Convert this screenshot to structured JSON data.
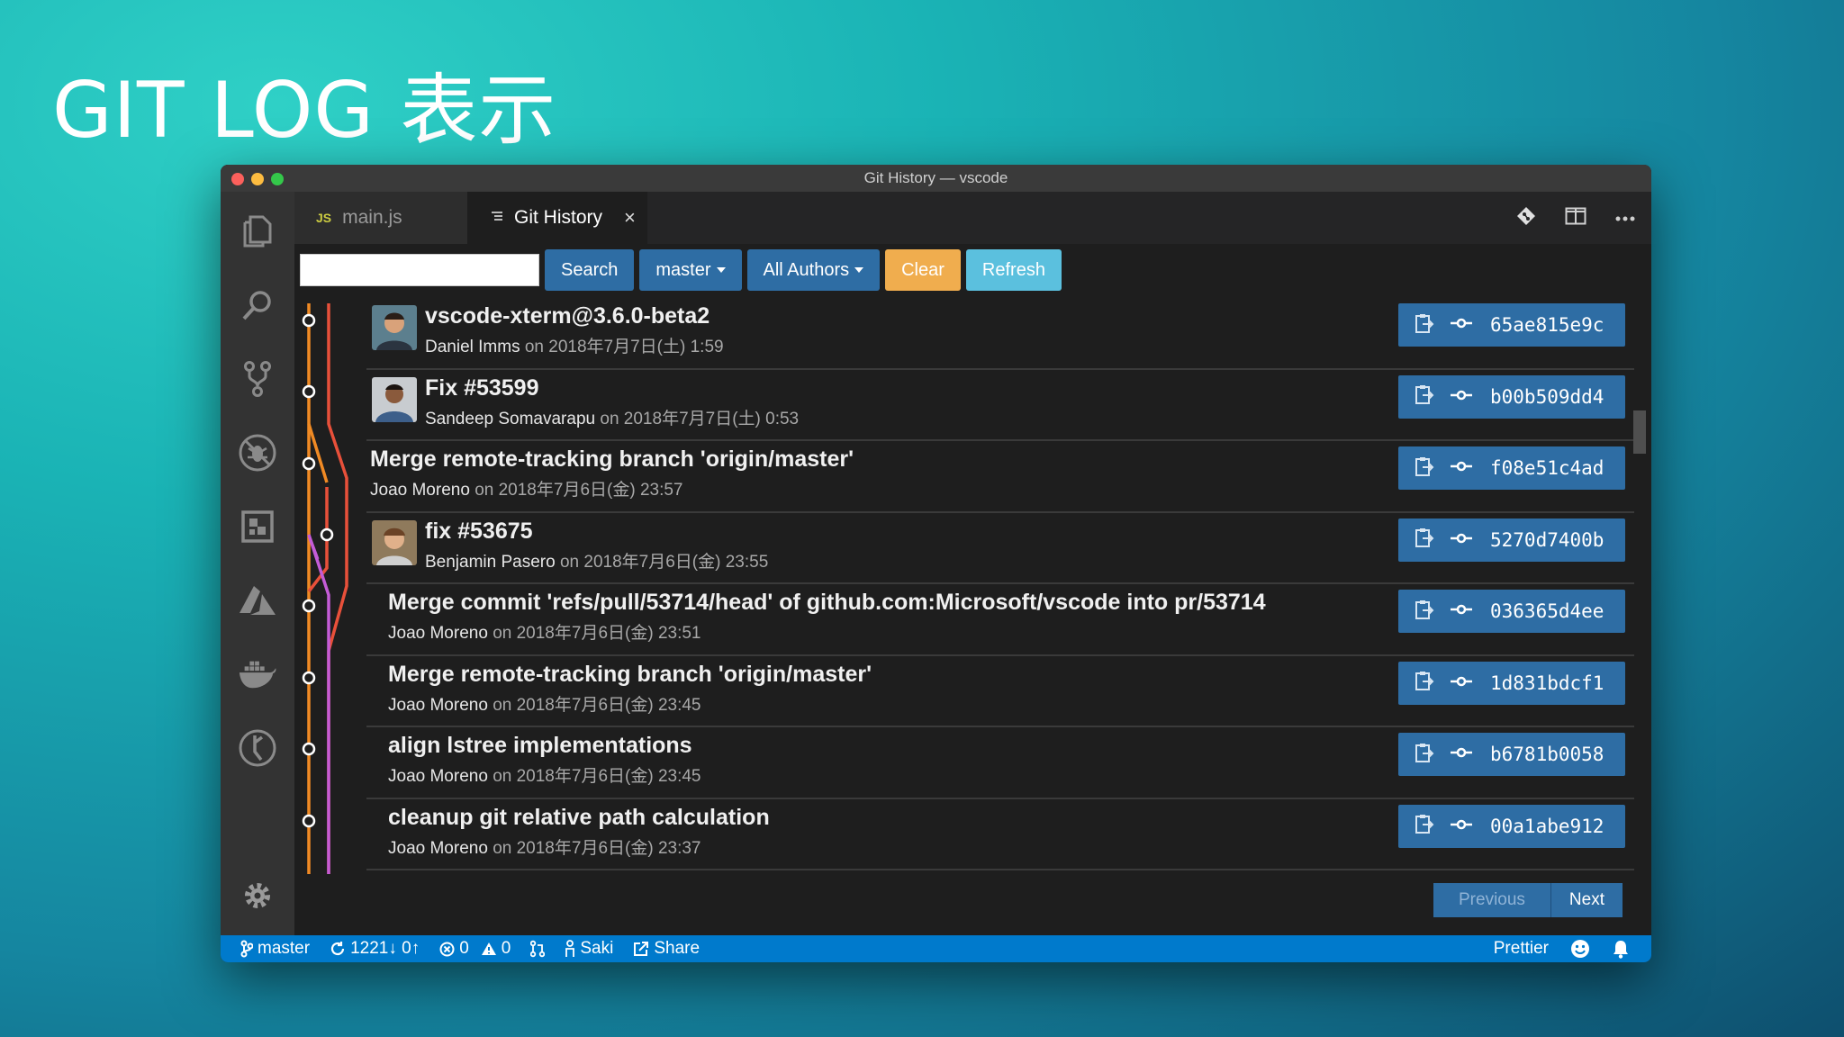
{
  "slide": {
    "title": "GIT LOG 表示"
  },
  "window": {
    "title": "Git History — vscode"
  },
  "tabs": [
    {
      "badge": "JS",
      "label": "main.js"
    },
    {
      "label": "Git History",
      "close": "×"
    }
  ],
  "toolbar": {
    "search_value": "",
    "search_label": "Search",
    "branch_label": "master",
    "authors_label": "All Authors",
    "clear_label": "Clear",
    "refresh_label": "Refresh"
  },
  "commits": [
    {
      "message": "vscode-xterm@3.6.0-beta2",
      "author": "Daniel Imms",
      "on": "on",
      "date": "2018年7月7日(土) 1:59",
      "hash": "65ae815e9c"
    },
    {
      "message": "Fix #53599",
      "author": "Sandeep Somavarapu",
      "on": "on",
      "date": "2018年7月7日(土) 0:53",
      "hash": "b00b509dd4"
    },
    {
      "message": "Merge remote-tracking branch 'origin/master'",
      "author": "Joao Moreno",
      "on": "on",
      "date": "2018年7月6日(金) 23:57",
      "hash": "f08e51c4ad"
    },
    {
      "message": "fix #53675",
      "author": "Benjamin Pasero",
      "on": "on",
      "date": "2018年7月6日(金) 23:55",
      "hash": "5270d7400b"
    },
    {
      "message": "Merge commit 'refs/pull/53714/head' of github.com:Microsoft/vscode into pr/53714",
      "author": "Joao Moreno",
      "on": "on",
      "date": "2018年7月6日(金) 23:51",
      "hash": "036365d4ee"
    },
    {
      "message": "Merge remote-tracking branch 'origin/master'",
      "author": "Joao Moreno",
      "on": "on",
      "date": "2018年7月6日(金) 23:45",
      "hash": "1d831bdcf1"
    },
    {
      "message": "align lstree implementations",
      "author": "Joao Moreno",
      "on": "on",
      "date": "2018年7月6日(金) 23:45",
      "hash": "b6781b0058"
    },
    {
      "message": "cleanup git relative path calculation",
      "author": "Joao Moreno",
      "on": "on",
      "date": "2018年7月6日(金) 23:37",
      "hash": "00a1abe912"
    }
  ],
  "pager": {
    "previous": "Previous",
    "next": "Next"
  },
  "statusbar": {
    "branch": "master",
    "sync": "1221↓ 0↑",
    "errors": "0",
    "warnings": "0",
    "live_share_user": "Saki",
    "share": "Share",
    "formatter": "Prettier"
  },
  "colors": {
    "accent_blue": "#2e6da4",
    "clear_orange": "#f0ad4e",
    "refresh_cyan": "#5bc0de",
    "statusbar": "#007acc",
    "graph_orange": "#f08a24",
    "graph_red": "#e8503a",
    "graph_purple": "#c45cd6"
  }
}
